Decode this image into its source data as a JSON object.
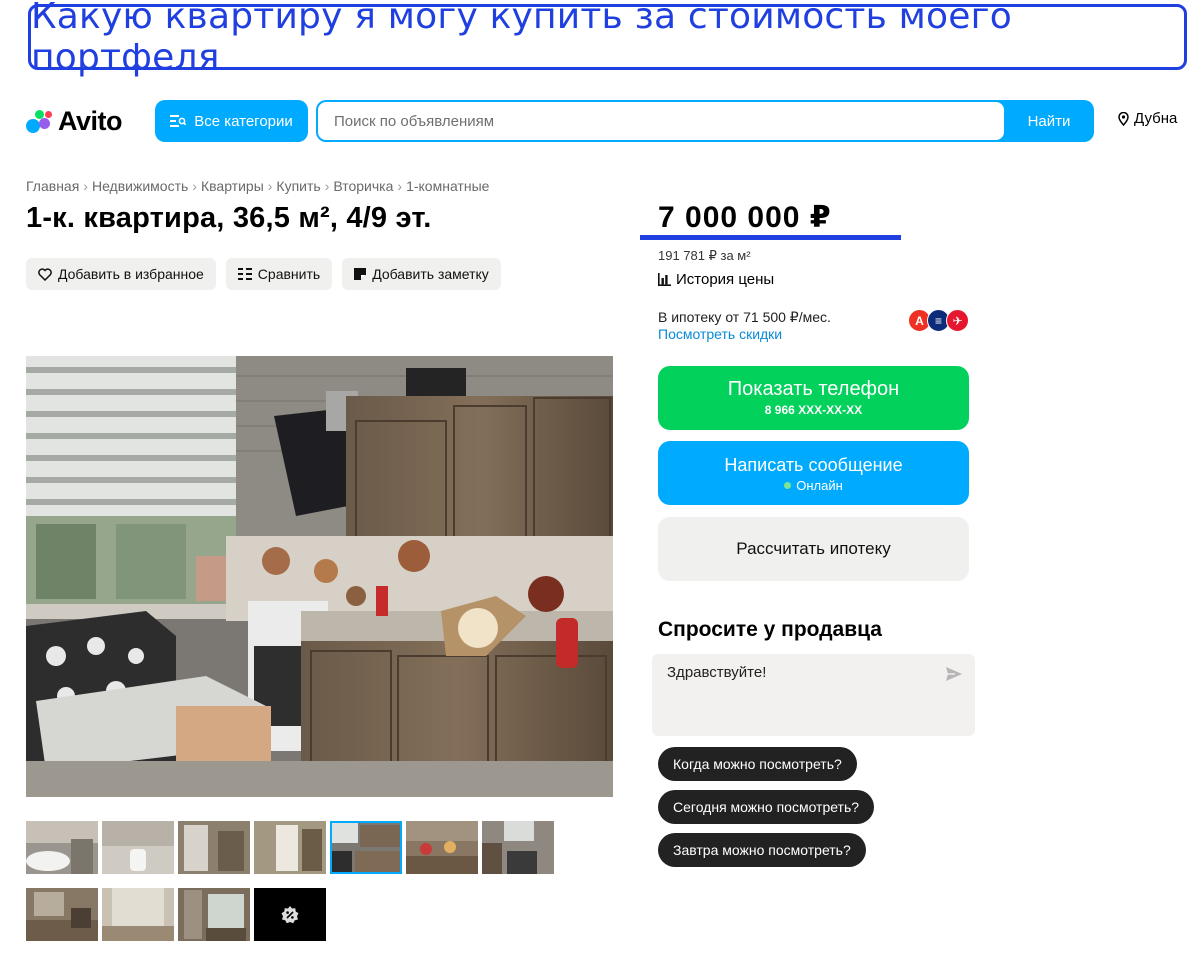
{
  "banner": {
    "text": "Какую квартиру я могу купить за стоимость моего портфеля"
  },
  "header": {
    "brand": "Avito",
    "categories_label": "Все категории",
    "search_placeholder": "Поиск по объявлениям",
    "search_button": "Найти",
    "location": "Дубна",
    "accent_color": "#00aaff"
  },
  "breadcrumbs": [
    "Главная",
    "Недвижимость",
    "Квартиры",
    "Купить",
    "Вторичка",
    "1-комнатные"
  ],
  "listing": {
    "title": "1-к. квартира, 36,5 м², 4/9 эт.",
    "actions": {
      "favorite": "Добавить в избранное",
      "compare": "Сравнить",
      "note": "Добавить заметку"
    },
    "thumbnail_count": 11,
    "active_thumbnail": 5
  },
  "price": {
    "value": "7 000 000 ₽",
    "per_meter": "191 781 ₽ за м²",
    "history": "История цены",
    "mortgage": "В ипотеку от 71 500 ₽/мес.",
    "mortgage_link": "Посмотреть скидки",
    "banks": [
      "А",
      "≡",
      "✈"
    ]
  },
  "contact": {
    "show_phone": "Показать телефон",
    "phone_masked": "8 966 XXX-XX-XX",
    "write_message": "Написать сообщение",
    "online_status": "Онлайн",
    "calc_mortgage": "Рассчитать ипотеку"
  },
  "ask_seller": {
    "title": "Спросите у продавца",
    "message": "Здравствуйте!",
    "quick_questions": [
      "Когда можно посмотреть?",
      "Сегодня можно посмотреть?",
      "Завтра можно посмотреть?"
    ]
  }
}
